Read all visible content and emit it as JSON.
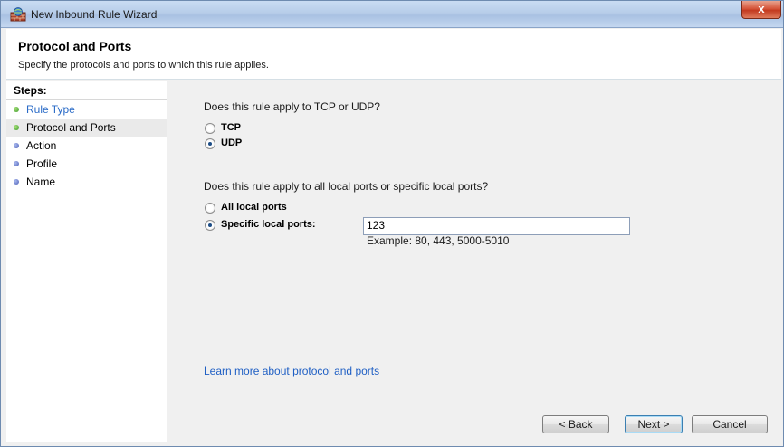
{
  "window": {
    "title": "New Inbound Rule Wizard",
    "close_glyph": "x"
  },
  "header": {
    "title": "Protocol and Ports",
    "subtitle": "Specify the protocols and ports to which this rule applies."
  },
  "steps": {
    "title": "Steps:",
    "items": [
      {
        "label": "Rule Type",
        "state": "completed-link"
      },
      {
        "label": "Protocol and Ports",
        "state": "current"
      },
      {
        "label": "Action",
        "state": "pending"
      },
      {
        "label": "Profile",
        "state": "pending"
      },
      {
        "label": "Name",
        "state": "pending"
      }
    ]
  },
  "protocol": {
    "question": "Does this rule apply to TCP or UDP?",
    "options": [
      {
        "label": "TCP",
        "checked": false
      },
      {
        "label": "UDP",
        "checked": true
      }
    ]
  },
  "ports": {
    "question": "Does this rule apply to all local ports or specific local ports?",
    "options": [
      {
        "label": "All local ports",
        "checked": false
      },
      {
        "label": "Specific local ports:",
        "checked": true
      }
    ],
    "value": "123",
    "example": "Example: 80, 443, 5000-5010"
  },
  "learn_more": "Learn more about protocol and ports",
  "buttons": {
    "back": "< Back",
    "next": "Next >",
    "cancel": "Cancel"
  },
  "colors": {
    "link": "#1f5fc4",
    "step_done": "#3b9a2a",
    "step_pending": "#4d5fb6"
  }
}
